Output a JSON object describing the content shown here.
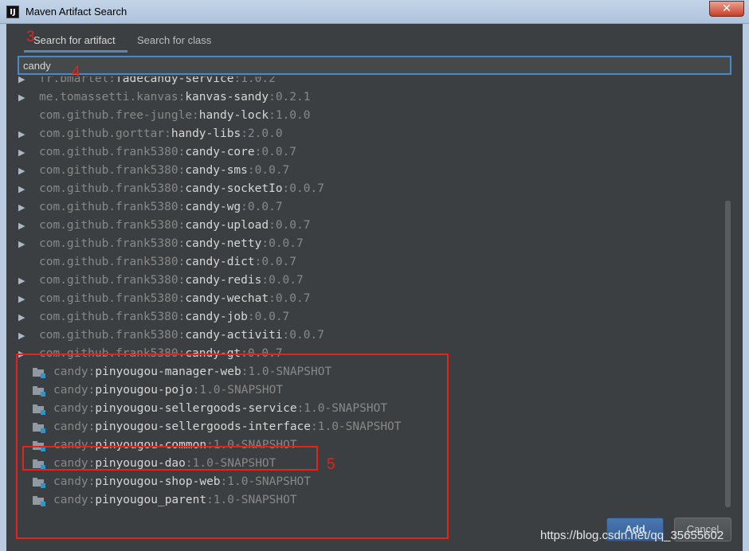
{
  "window": {
    "title": "Maven Artifact Search",
    "app_icon": "IJ"
  },
  "tabs": [
    {
      "label": "Search for artifact",
      "active": true
    },
    {
      "label": "Search for class",
      "active": false
    }
  ],
  "search": {
    "value": "candy"
  },
  "results": [
    {
      "arrow": "▶",
      "group": "fr.bmartel:",
      "artifact": "fadecandy-service",
      "version": ":1.0.2",
      "icon": ""
    },
    {
      "arrow": "▶",
      "group": "me.tomassetti.kanvas:",
      "artifact": "kanvas-sandy",
      "version": ":0.2.1",
      "icon": ""
    },
    {
      "arrow": "",
      "group": "com.github.free-jungle:",
      "artifact": "handy-lock",
      "version": ":1.0.0",
      "icon": ""
    },
    {
      "arrow": "▶",
      "group": "com.github.gorttar:",
      "artifact": "handy-libs",
      "version": ":2.0.0",
      "icon": ""
    },
    {
      "arrow": "▶",
      "group": "com.github.frank5380:",
      "artifact": "candy-core",
      "version": ":0.0.7",
      "icon": ""
    },
    {
      "arrow": "▶",
      "group": "com.github.frank5380:",
      "artifact": "candy-sms",
      "version": ":0.0.7",
      "icon": ""
    },
    {
      "arrow": "▶",
      "group": "com.github.frank5380:",
      "artifact": "candy-socketIo",
      "version": ":0.0.7",
      "icon": ""
    },
    {
      "arrow": "▶",
      "group": "com.github.frank5380:",
      "artifact": "candy-wg",
      "version": ":0.0.7",
      "icon": ""
    },
    {
      "arrow": "▶",
      "group": "com.github.frank5380:",
      "artifact": "candy-upload",
      "version": ":0.0.7",
      "icon": ""
    },
    {
      "arrow": "▶",
      "group": "com.github.frank5380:",
      "artifact": "candy-netty",
      "version": ":0.0.7",
      "icon": ""
    },
    {
      "arrow": "",
      "group": "com.github.frank5380:",
      "artifact": "candy-dict",
      "version": ":0.0.7",
      "icon": ""
    },
    {
      "arrow": "▶",
      "group": "com.github.frank5380:",
      "artifact": "candy-redis",
      "version": ":0.0.7",
      "icon": ""
    },
    {
      "arrow": "▶",
      "group": "com.github.frank5380:",
      "artifact": "candy-wechat",
      "version": ":0.0.7",
      "icon": ""
    },
    {
      "arrow": "▶",
      "group": "com.github.frank5380:",
      "artifact": "candy-job",
      "version": ":0.0.7",
      "icon": ""
    },
    {
      "arrow": "▶",
      "group": "com.github.frank5380:",
      "artifact": "candy-activiti",
      "version": ":0.0.7",
      "icon": ""
    },
    {
      "arrow": "▶",
      "group": "com.github.frank5380:",
      "artifact": "candy-gt",
      "version": ":0.0.7",
      "icon": ""
    },
    {
      "arrow": "",
      "group": "candy:",
      "artifact": "pinyougou-manager-web",
      "version": ":1.0-SNAPSHOT",
      "icon": "module-folder-icon"
    },
    {
      "arrow": "",
      "group": "candy:",
      "artifact": "pinyougou-pojo",
      "version": ":1.0-SNAPSHOT",
      "icon": "module-folder-icon"
    },
    {
      "arrow": "",
      "group": "candy:",
      "artifact": "pinyougou-sellergoods-service",
      "version": ":1.0-SNAPSHOT",
      "icon": "module-folder-icon"
    },
    {
      "arrow": "",
      "group": "candy:",
      "artifact": "pinyougou-sellergoods-interface",
      "version": ":1.0-SNAPSHOT",
      "icon": "module-folder-icon"
    },
    {
      "arrow": "",
      "group": "candy:",
      "artifact": "pinyougou-common",
      "version": ":1.0-SNAPSHOT",
      "icon": "module-folder-icon"
    },
    {
      "arrow": "",
      "group": "candy:",
      "artifact": "pinyougou-dao",
      "version": ":1.0-SNAPSHOT",
      "icon": "module-folder-icon"
    },
    {
      "arrow": "",
      "group": "candy:",
      "artifact": "pinyougou-shop-web",
      "version": ":1.0-SNAPSHOT",
      "icon": "module-folder-icon"
    },
    {
      "arrow": "",
      "group": "candy:",
      "artifact": "pinyougou_parent",
      "version": ":1.0-SNAPSHOT",
      "icon": "module-folder-icon"
    }
  ],
  "buttons": {
    "add": "Add",
    "cancel": "Cancel"
  },
  "annotations": {
    "n3": "3",
    "n4": "4",
    "n5": "5"
  },
  "watermark": "https://blog.csdn.net/qq_35655602",
  "colors": {
    "accent": "#4a88c7",
    "annotation_red": "#e3241b",
    "background": "#3c3f41"
  }
}
